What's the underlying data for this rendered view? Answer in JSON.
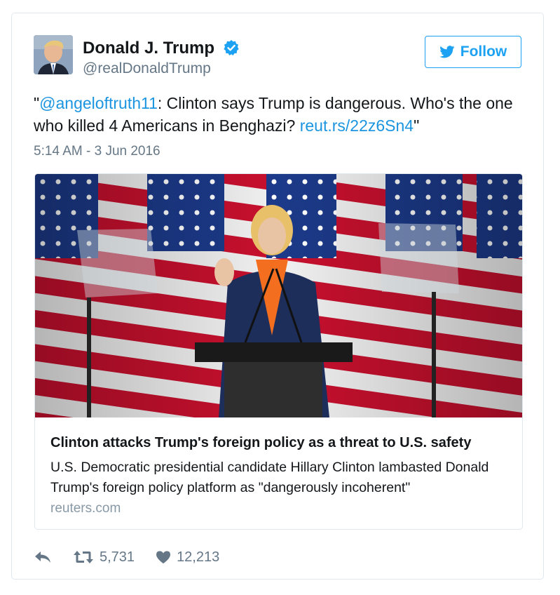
{
  "tweet": {
    "name": "Donald J. Trump",
    "handle": "@realDonaldTrump",
    "follow_label": "Follow",
    "text": {
      "quote_open": "\"",
      "mention": "@angeloftruth11",
      "body": ": Clinton says Trump is dangerous. Who's the one who killed 4 Americans in Benghazi? ",
      "link": "reut.rs/22z6Sn4",
      "quote_close": "\""
    },
    "timestamp": "5:14 AM - 3 Jun 2016"
  },
  "card": {
    "title": "Clinton attacks Trump's foreign policy as a threat to U.S. safety",
    "description": "U.S. Democratic presidential candidate Hillary Clinton lambasted Donald Trump's foreign policy platform as \"dangerously incoherent\"",
    "domain": "reuters.com"
  },
  "actions": {
    "retweets": "5,731",
    "likes": "12,213"
  },
  "colors": {
    "brand_blue": "#1da1f2",
    "link_blue": "#1b95e0",
    "muted": "#657786",
    "border": "#e1e8ed"
  },
  "icons": [
    "verified-badge-icon",
    "twitter-bird-icon",
    "reply-icon",
    "retweet-icon",
    "heart-icon"
  ]
}
